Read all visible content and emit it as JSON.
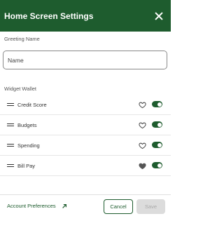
{
  "header": {
    "title": "Home Screen Settings",
    "close_icon": "close-icon"
  },
  "greeting": {
    "label": "Greeting Name",
    "placeholder": "Name",
    "value": ""
  },
  "wallet": {
    "label": "Widget Wallet",
    "items": [
      {
        "label": "Credit Score",
        "favorite": false,
        "enabled": true
      },
      {
        "label": "Budgets",
        "favorite": false,
        "enabled": true
      },
      {
        "label": "Spending",
        "favorite": false,
        "enabled": true
      },
      {
        "label": "Bill Pay",
        "favorite": true,
        "enabled": true
      }
    ]
  },
  "footer": {
    "account_preferences": "Account Preferences",
    "arrow_icon": "arrow-up-right-icon",
    "cancel_label": "Cancel",
    "save_label": "Save"
  },
  "colors": {
    "brand": "#1e5c2e",
    "disabled_bg": "#dcdcdc",
    "disabled_text": "#aaaaaa"
  }
}
